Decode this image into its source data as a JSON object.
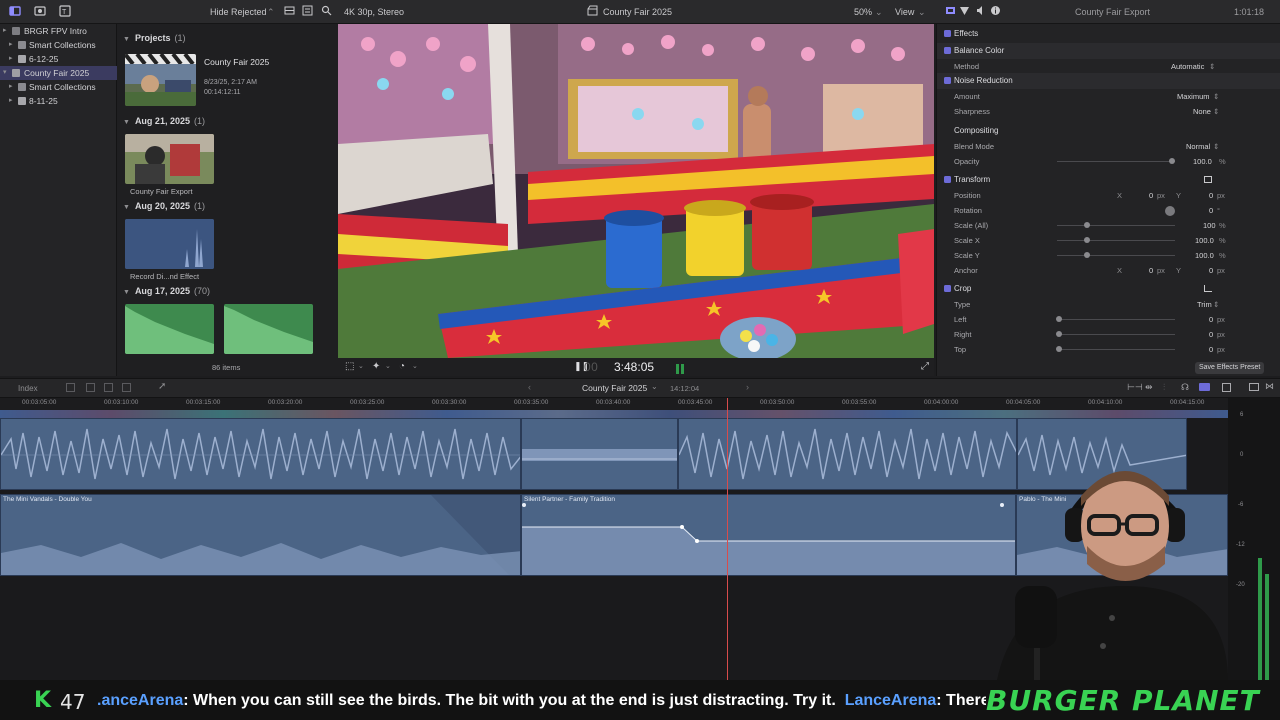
{
  "topbar": {
    "hide_rejected": "Hide Rejected",
    "format": "4K 30p, Stereo",
    "project_title": "County Fair 2025",
    "zoom": "50%",
    "view": "View",
    "inspector_title": "County Fair Export",
    "duration": "1:01:18"
  },
  "library": {
    "items": [
      {
        "label": "BRGR FPV Intro"
      },
      {
        "label": "Smart Collections"
      },
      {
        "label": "6-12-25"
      },
      {
        "label": "County Fair 2025"
      },
      {
        "label": "Smart Collections"
      },
      {
        "label": "8-11-25"
      }
    ]
  },
  "browser": {
    "projects_header": "Projects",
    "projects_count": "(1)",
    "project_name": "County Fair 2025",
    "project_date": "8/23/25, 2:17 AM",
    "project_duration": "00:14:12:11",
    "groups": [
      {
        "date": "Aug 21, 2025",
        "count": "(1)",
        "caption": "County Fair Export"
      },
      {
        "date": "Aug 20, 2025",
        "count": "(1)",
        "caption": "Record Di...nd Effect"
      },
      {
        "date": "Aug 17, 2025",
        "count": "(70)"
      }
    ],
    "items_count": "86 items"
  },
  "viewer": {
    "timecode": "3:48:05"
  },
  "inspector": {
    "effects": "Effects",
    "balance_color": "Balance Color",
    "method_label": "Method",
    "method_value": "Automatic",
    "noise_reduction": "Noise Reduction",
    "amount_label": "Amount",
    "amount_value": "Maximum",
    "sharpness_label": "Sharpness",
    "sharpness_value": "None",
    "compositing": "Compositing",
    "blend_label": "Blend Mode",
    "blend_value": "Normal",
    "opacity_label": "Opacity",
    "opacity_value": "100.0",
    "transform": "Transform",
    "position_label": "Position",
    "position_x": "0",
    "position_y": "0",
    "rotation_label": "Rotation",
    "rotation_value": "0",
    "scale_all_label": "Scale (All)",
    "scale_all_value": "100",
    "scale_x_label": "Scale X",
    "scale_x_value": "100.0",
    "scale_y_label": "Scale Y",
    "scale_y_value": "100.0",
    "anchor_label": "Anchor",
    "anchor_x": "0",
    "anchor_y": "0",
    "crop": "Crop",
    "type_label": "Type",
    "type_value": "Trim",
    "left_label": "Left",
    "left_value": "0",
    "right_label": "Right",
    "right_value": "0",
    "top_label": "Top",
    "top_value": "0",
    "unit_px": "px",
    "unit_pct": "%",
    "unit_deg": "°",
    "axis_x": "X",
    "axis_y": "Y",
    "save_preset": "Save Effects Preset"
  },
  "timeline": {
    "index": "Index",
    "project": "County Fair 2025",
    "project_duration": "14:12:04",
    "ruler_labels": [
      "00:03:05:00",
      "00:03:10:00",
      "00:03:15:00",
      "00:03:20:00",
      "00:03:25:00",
      "00:03:30:00",
      "00:03:35:00",
      "00:03:40:00",
      "00:03:45:00",
      "00:03:50:00",
      "00:03:55:00",
      "00:04:00:00",
      "00:04:05:00",
      "00:04:10:00",
      "00:04:15:00"
    ],
    "clips": [
      {
        "title": "The Mini Vandals - Double You"
      },
      {
        "title": "Silent Partner - Family Tradition"
      },
      {
        "title": "Pablo - The Mini"
      }
    ],
    "meter_labels": [
      "6",
      "0",
      "-6",
      "-12",
      "-20"
    ]
  },
  "chat": {
    "k_glyph": "K",
    "count": "47",
    "user1": ".anceArena",
    "message1": ": When you can still see the birds. The bit with you at the end is just distracting. Try it.",
    "user2": "LanceArena",
    "message2": ": There",
    "brand": "BURGER PLANET"
  }
}
